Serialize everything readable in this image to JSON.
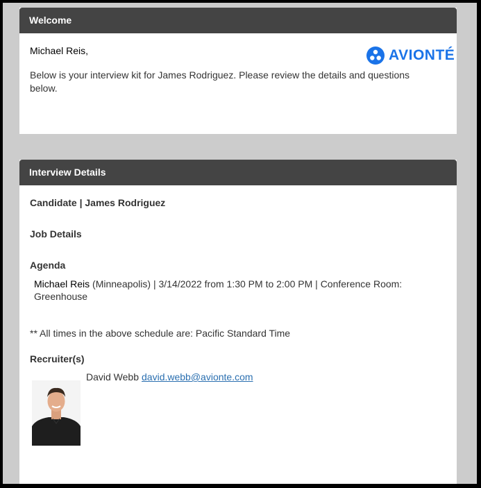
{
  "welcome": {
    "header": "Welcome",
    "greeting_name": "Michael Reis",
    "greeting_suffix": ",",
    "brand": "AVIONTÉ",
    "intro": "Below is your interview kit for James Rodriguez. Please review the details and questions below."
  },
  "details": {
    "header": "Interview Details",
    "candidate_label": "Candidate | James Rodriguez",
    "job_details_label": "Job Details",
    "agenda_label": "Agenda",
    "agenda": {
      "interviewer": "Michael Reis",
      "details": " (Minneapolis) | 3/14/2022 from 1:30 PM to 2:00 PM | Conference Room: Greenhouse"
    },
    "timezone_note": "** All times in the above schedule are: Pacific Standard Time",
    "recruiters_label": "Recruiter(s)",
    "recruiter": {
      "name": "David Webb",
      "email": "david.webb@avionte.com"
    }
  },
  "colors": {
    "header_bg": "#444444",
    "page_bg": "#cccccc",
    "brand_blue": "#1a73e8",
    "link": "#2a6fb0"
  }
}
